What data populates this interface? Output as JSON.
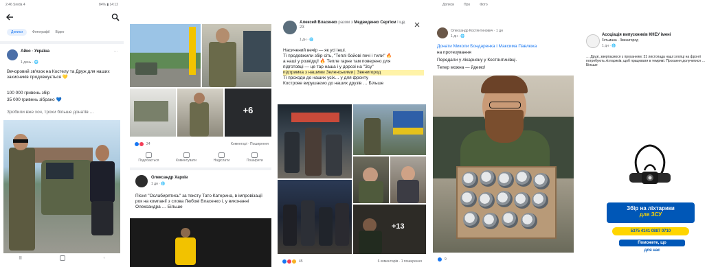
{
  "colors": {
    "fb_blue": "#1877f2",
    "ua_blue": "#0057b7",
    "ua_yellow": "#ffd500",
    "text": "#1c1e21",
    "muted": "#65676b"
  },
  "p1": {
    "status_left": "2:46 Sreda 4",
    "status_right": "84% ▮ 14:12",
    "back_icon": "arrow-left-icon",
    "search_icon": "search-icon",
    "tabs": [
      "Дописи",
      "Фотографії",
      "Відео"
    ],
    "post_author": "Айко · Україна",
    "post_meta": "… Україна",
    "post_time": "1 день · 🌐",
    "post_text": "Вечоровий зв'язок на Костелу та Друж для наших захисників продовжується 💛",
    "post_line2": "100 000 гривень збір",
    "post_line3": "35 000 гривень зібрано 💙",
    "post_line4": "Зробили вже хоч, трохи більше донатів …",
    "nav_icons": [
      "menu-lines-icon",
      "home-square-icon",
      "back-chevron-icon"
    ]
  },
  "p2": {
    "more_count": "+6",
    "reactions_count": "24",
    "comments_shares": "Коментарі · Поширення",
    "actions": [
      "Подобається",
      "Коментувати",
      "Надіслати",
      "Поширити"
    ],
    "post2_author": "Олександр Харків",
    "post2_time": "1 дн · 🌐",
    "post2_text": "Пісня \"Ослабирятись\" за тексту Тато Катерина, в імпровізації рок на компанії з слова Любові Власенко і, у виконанні Олександра … Більше"
  },
  "p3": {
    "author": "Алексей Власенко",
    "author_suffix": "разом з",
    "coauthor": "Медведенко Сергієм",
    "meta": "і ще 23",
    "time": "1 дн · 🌐",
    "more_icon": "more-dots-icon",
    "close_icon": "close-icon",
    "lines": [
      "Насичений вечір — як усі інші.",
      "Ті продовжили збір сіть, \"Теплі бойові печі і тили\" 🔥",
      "а наші у розвідці! 🔥 Тепле гарне там поверено для",
      "підготовці — це тар наша і у дорозі на \"Зсу\"",
      "ідемо з наших з Зеленських і ",
      "Ті проходи до наших усіх… у для фронту",
      "Кострове вирушаємо до наших друзів … Більше"
    ],
    "highlight": "підтримка з нашими Зеленськими | Звенигород",
    "photo_badge": "+13",
    "reactions_count": "45",
    "comments_shares": "6 коментарів · 1 поширення"
  },
  "p4": {
    "tabs": [
      "Дописи",
      "Про",
      "Фото"
    ],
    "author_meta": "Олександр Костянтинович · 1 дн",
    "time": "1 дн · 🌐",
    "mention_line": "Донати Миколи Бондаренка і Максима Павлюка",
    "line2": "на протезування",
    "line3": "Передали у лікарняну у Костянтинівці.",
    "line4": "Тепер можна — йдемо!",
    "reactions_count": "9"
  },
  "p5": {
    "org_name": "Асоціація випускників КНЕУ імені",
    "org_sub": "Гетьмана · Звенигород",
    "time": "1 дн · 🌐",
    "text": "… Друзі, звертаємося з проханням: 31 листопада наші хлопці на фронті потребують ліхтариків, щоб працювати в темряві. Прохання долучитися … Більше",
    "banner_title": "Збір на ліхтарики",
    "banner_zsu": "для ЗСУ",
    "card_number": "5375 4141 0887 0710",
    "thanks_line1": "Поможете, що",
    "thanks_line2": "для нас"
  }
}
